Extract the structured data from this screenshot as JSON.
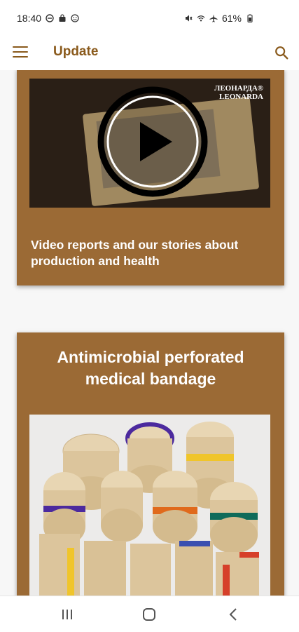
{
  "status_bar": {
    "time": "18:40",
    "battery": "61%"
  },
  "app_bar": {
    "title": "Update",
    "menu_icon": "hamburger-menu-icon",
    "search_icon": "search-icon"
  },
  "feed": {
    "video_card": {
      "logo_line1": "ЛЕОНАРДА®",
      "logo_line2": "LEONARDA",
      "caption": "Video reports and our stories about production and health",
      "play_icon": "play-icon"
    },
    "product_card": {
      "title": "Antimicrobial perforated medical bandage"
    }
  },
  "nav_bar": {
    "recents_icon": "recents-icon",
    "home_icon": "home-icon",
    "back_icon": "back-icon"
  },
  "colors": {
    "accent": "#8a5a1c",
    "card": "#9b6a35",
    "background": "#f7f7f7"
  }
}
